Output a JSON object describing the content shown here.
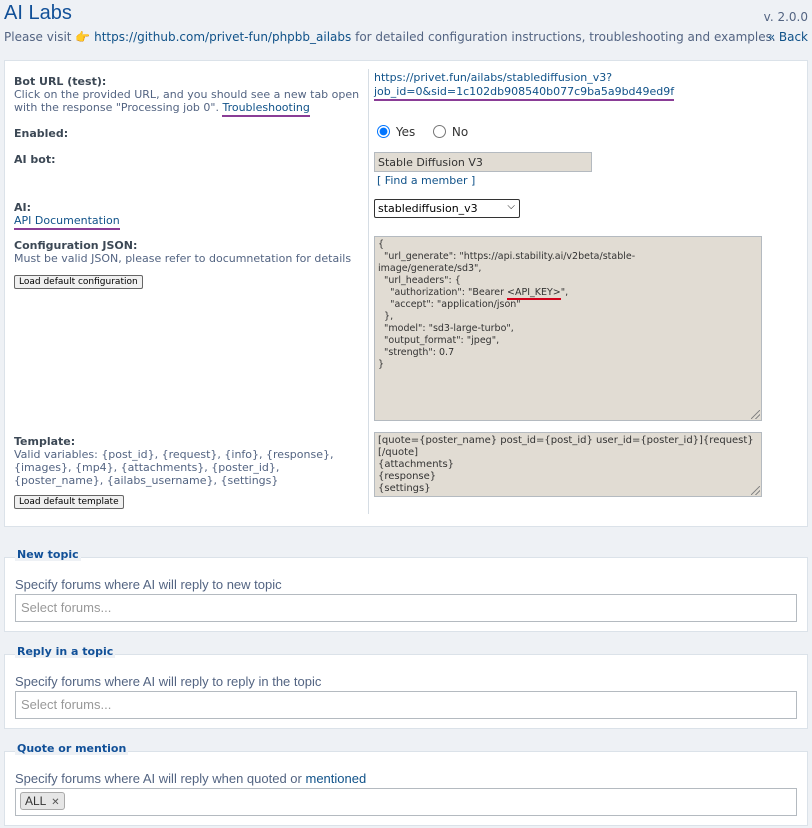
{
  "header": {
    "title": "AI Labs",
    "version": "v. 2.0.0",
    "visit_prefix": "Please visit",
    "visit_emoji": "👉",
    "repo_link": "https://github.com/privet-fun/phpbb_ailabs",
    "visit_suffix": "for detailed configuration instructions, troubleshooting and examples.",
    "back_link": "« Back"
  },
  "bot_url": {
    "label": "Bot URL (test):",
    "description": "Click on the provided URL, and you should see a new tab open with the response \"Processing job 0\".",
    "troubleshooting": "Troubleshooting",
    "url_line1": "https://privet.fun/ailabs/stablediffusion_v3?",
    "url_line2": "job_id=0&sid=1c102db908540b077c9ba5a9bd49ed9f"
  },
  "enabled": {
    "label": "Enabled:",
    "yes": "Yes",
    "no": "No",
    "selected": "Yes"
  },
  "ai_bot": {
    "label": "AI bot:",
    "value": "Stable Diffusion V3",
    "find_member": "[ Find a member ]"
  },
  "ai": {
    "label": "AI:",
    "api_doc": "API Documentation",
    "selected": "stablediffusion_v3"
  },
  "config_json": {
    "label": "Configuration JSON:",
    "description": "Must be valid JSON, please refer to documnetation for details",
    "load_button": "Load default configuration",
    "content_a": "{\n  \"url_generate\": \"https://api.stability.ai/v2beta/stable-\nimage/generate/sd3\",\n  \"url_headers\": {\n    \"authorization\": \"Bearer ",
    "content_key": "<API_KEY>",
    "content_b": "\",\n    \"accept\": \"application/json\"\n  },\n  \"model\": \"sd3-large-turbo\",\n  \"output_format\": \"jpeg\",\n  \"strength\": 0.7\n}"
  },
  "template": {
    "label": "Template:",
    "description": "Valid variables: {post_id}, {request}, {info}, {response}, {images}, {mp4}, {attachments}, {poster_id}, {poster_name}, {ailabs_username}, {settings}",
    "load_button": "Load default template",
    "content": "[quote={poster_name} post_id={post_id} user_id={poster_id}]{request}\n[/quote]\n{attachments}\n{response}\n{settings}"
  },
  "new_topic": {
    "legend": "New topic",
    "description": "Specify forums where AI will reply to new topic",
    "placeholder": "Select forums..."
  },
  "reply_topic": {
    "legend": "Reply in a topic",
    "description": "Specify forums where AI will reply to reply in the topic",
    "placeholder": "Select forums..."
  },
  "quote_mention": {
    "legend": "Quote or mention",
    "description_prefix": "Specify forums where AI will reply when quoted or",
    "mentioned_link": "mentioned",
    "tag": "ALL",
    "tag_remove": "✕"
  },
  "colors": {
    "link": "#105289",
    "title": "#115098",
    "annotation_purple": "#8a3d96",
    "annotation_red": "#d0021b"
  }
}
